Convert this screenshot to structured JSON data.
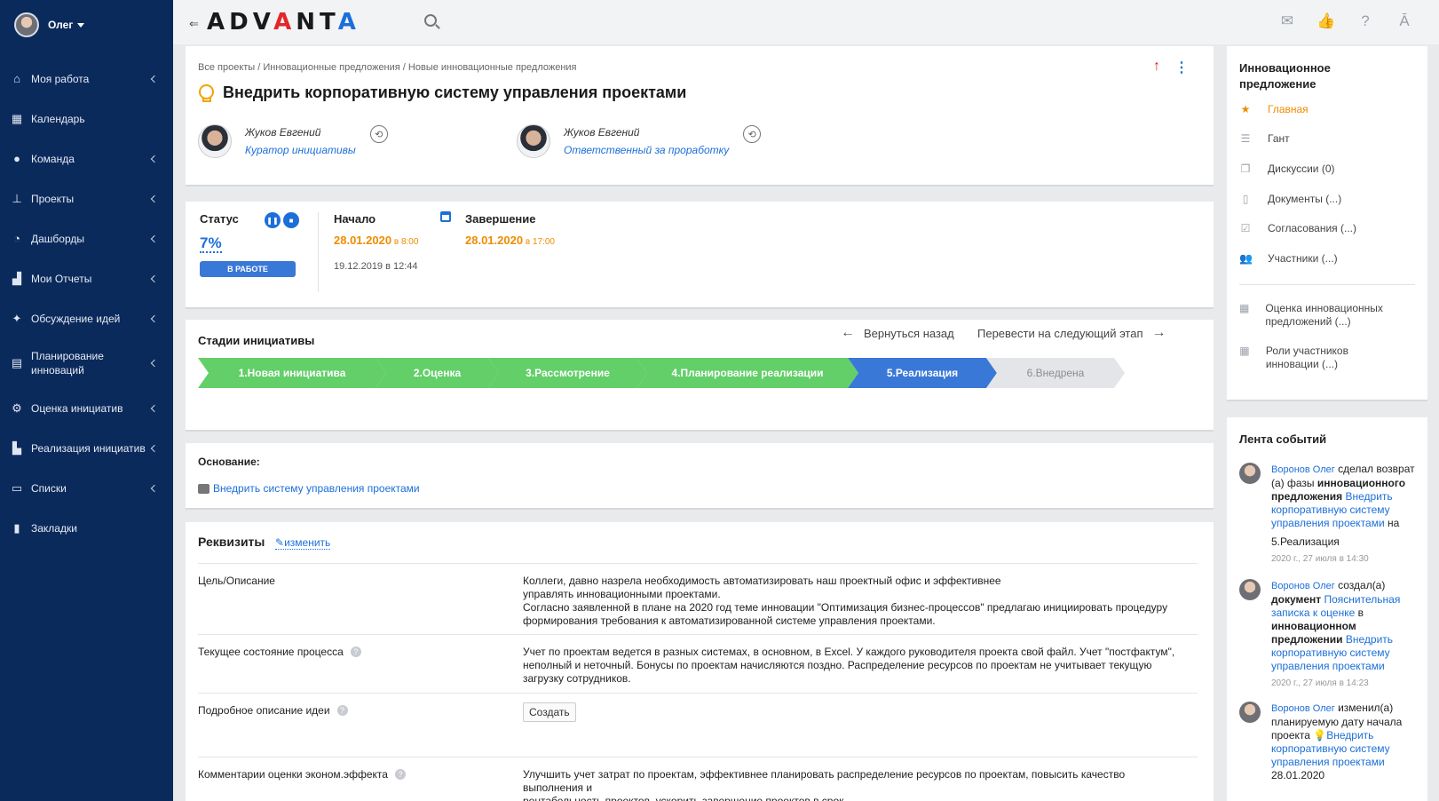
{
  "sidebar": {
    "user_name": "Олег",
    "items": [
      {
        "label": "Моя работа",
        "icon": "home-icon",
        "chevron": true
      },
      {
        "label": "Календарь",
        "icon": "calendar-icon",
        "chevron": false
      },
      {
        "label": "Команда",
        "icon": "team-icon",
        "chevron": true
      },
      {
        "label": "Проекты",
        "icon": "projects-icon",
        "chevron": true
      },
      {
        "label": "Дашборды",
        "icon": "dashboard-icon",
        "chevron": true
      },
      {
        "label": "Мои Отчеты",
        "icon": "reports-icon",
        "chevron": true
      },
      {
        "label": "Обсуждение идей",
        "icon": "ideas-icon",
        "chevron": true
      },
      {
        "label": "Планирование инноваций",
        "icon": "planning-icon",
        "chevron": true
      },
      {
        "label": "Оценка инициатив",
        "icon": "evaluation-icon",
        "chevron": true
      },
      {
        "label": "Реализация инициатив",
        "icon": "implementation-icon",
        "chevron": true
      },
      {
        "label": "Списки",
        "icon": "lists-icon",
        "chevron": true
      },
      {
        "label": "Закладки",
        "icon": "bookmark-icon",
        "chevron": false
      }
    ]
  },
  "header": {
    "logo_a": "A",
    "logo_d": "D",
    "logo_v": "V",
    "logo_a2": "A",
    "logo_nt": "NT",
    "logo_a3": "A",
    "icons": [
      "mail-icon",
      "like-icon",
      "help-icon",
      "advanta-icon"
    ]
  },
  "card_main": {
    "breadcrumb": [
      {
        "label": "Все проекты"
      },
      {
        "label": "Инновационные предложения"
      },
      {
        "label": "Новые инновационные предложения"
      }
    ],
    "separator": " / ",
    "title": "Внедрить корпоративную систему управления проектами",
    "people": [
      {
        "name": "Жуков Евгений",
        "role": "Куратор инициативы"
      },
      {
        "name": "Жуков Евгений",
        "role": "Ответственный за проработку"
      }
    ]
  },
  "status": {
    "label": "Статус",
    "percent": "7%",
    "badge": "В РАБОТЕ",
    "start_label": "Начало",
    "start_date": "28.01.2020",
    "start_time": " в 8:00",
    "end_label": "Завершение",
    "end_date": "28.01.2020",
    "end_time": " в 17:00",
    "created": "19.12.2019 в 12:44"
  },
  "stages": {
    "title": "Стадии инициативы",
    "back_label": "Вернуться назад",
    "next_label": "Перевести на следующий этап",
    "items": [
      {
        "label": "1.Новая инициатива",
        "state": "done"
      },
      {
        "label": "2.Оценка",
        "state": "done"
      },
      {
        "label": "3.Рассмотрение",
        "state": "done"
      },
      {
        "label": "4.Планирование реализации",
        "state": "done"
      },
      {
        "label": "5.Реализация",
        "state": "current"
      },
      {
        "label": "6.Внедрена",
        "state": "todo"
      }
    ],
    "colors": {
      "done": "#62cf69",
      "current": "#3a78d8",
      "todo": "#e3e5e8"
    }
  },
  "basis": {
    "label": "Основание:",
    "link": "Внедрить систему управления проектами"
  },
  "requisites": {
    "title": "Реквизиты",
    "edit_label": "изменить",
    "rows": [
      {
        "key": "Цель/Описание",
        "help": false,
        "value": "Коллеги, давно назрела необходимость автоматизировать наш проектный офис и эффективнее\nуправлять инновационными проектами.\nСогласно заявленной в плане на 2020 год теме инновации \"Оптимизация бизнес-процессов\" предлагаю инициировать процедуру\nформирования требования к автоматизированной системе управления проектами."
      },
      {
        "key": "Текущее состояние процесса",
        "help": true,
        "value": "Учет по проектам ведется в разных системах, в основном, в Excel. У каждого руководителя проекта свой файл. Учет \"постфактум\",\nнеполный и неточный. Бонусы по проектам начисляются поздно. Распределение ресурсов по проектам не учитывает текущую\nзагрузку сотрудников."
      },
      {
        "key": "Подробное описание идеи",
        "help": true,
        "button": "Создать"
      },
      {
        "key": "Комментарии оценки эконом.эффекта",
        "help": true,
        "value": "Улучшить учет затрат по проектам, эффективнее планировать распределение ресурсов по проектам, повысить качество выполнения и\nрентабельность проектов, ускорить завершение проектов в срок."
      }
    ]
  },
  "right_panel": {
    "title": "Инновационное предложение",
    "items": [
      {
        "label": "Главная",
        "icon": "star-icon",
        "active": true
      },
      {
        "label": "Гант",
        "icon": "gantt-icon",
        "active": false
      },
      {
        "label": "Дискуссии (0)",
        "icon": "discussion-icon",
        "active": false
      },
      {
        "label": "Документы (...)",
        "icon": "document-icon",
        "active": false
      },
      {
        "label": "Согласования (...)",
        "icon": "approval-icon",
        "active": false
      },
      {
        "label": "Участники (...)",
        "icon": "participants-icon",
        "active": false
      }
    ],
    "extra": [
      {
        "label": "Оценка инновационных предложений (...)",
        "icon": "table-icon"
      },
      {
        "label": "Роли участников инновации (...)",
        "icon": "table-icon"
      }
    ]
  },
  "events": {
    "title": "Лента событий",
    "items": [
      {
        "author": "Воронов Олег",
        "t1": " сделал возврат (а) фазы ",
        "b1": "инновационного предложения",
        "sp": " ",
        "link": "Внедрить корпоративную систему управления проектами",
        "t2": " на",
        "extra": "5.Реализация",
        "time": "2020 г., 27 июля в 14:30"
      },
      {
        "author": "Воронов Олег",
        "t1": " создал(а) ",
        "b1": "документ",
        "sp": " ",
        "link": "Пояснительная записка к оценке",
        "t2": " в ",
        "b2": "инновационном предложении",
        "link2": "Внедрить корпоративную систему управления проектами",
        "time": "2020 г., 27 июля в 14:23"
      },
      {
        "author": "Воронов Олег",
        "t1": " изменил(а) планируемую дату начала проекта ",
        "link": "Внедрить корпоративную систему управления проектами",
        "extra": "28.01.2020"
      }
    ]
  }
}
